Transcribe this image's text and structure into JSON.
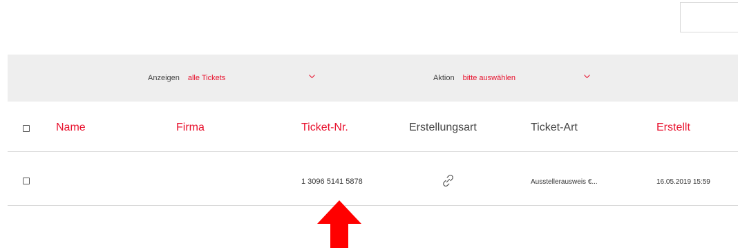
{
  "filter_bar": {
    "show_label": "Anzeigen",
    "show_value": "alle Tickets",
    "action_label": "Aktion",
    "action_value": "bitte auswählen"
  },
  "table": {
    "columns": [
      "Name",
      "Firma",
      "Ticket-Nr.",
      "Erstellungsart",
      "Ticket-Art",
      "Erstellt"
    ],
    "rows": [
      {
        "name": "",
        "company": "",
        "ticket_number": "1 3096 5141 5878",
        "creation_type_icon": "link-icon",
        "ticket_type": "Ausstellerausweis €...",
        "created": "16.05.2019 15:59"
      }
    ]
  },
  "colors": {
    "accent": "#e8112d",
    "filter_bar_bg": "#eeeeee",
    "divider": "#d9d9d9",
    "annotation_arrow": "#ff0000"
  },
  "annotation": {
    "icon": "arrow-up-icon"
  }
}
